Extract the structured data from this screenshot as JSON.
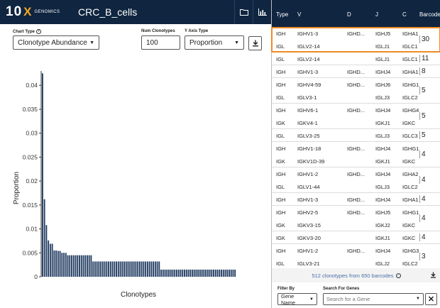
{
  "header": {
    "logo_ten": "10",
    "logo_x": "X",
    "logo_genomics": "GENOMICS",
    "title": "CRC_B_cells",
    "folder_icon": "folder-icon",
    "chart_icon": "bar-chart-icon"
  },
  "controls": {
    "chart_type_label": "Chart Type",
    "chart_type_value": "Clonotype Abundance",
    "num_clonotypes_label": "Num Clonotypes",
    "num_clonotypes_value": "100",
    "y_axis_label": "Y Axis Type",
    "y_axis_value": "Proportion",
    "download_icon": "download-icon"
  },
  "chart_data": {
    "type": "bar",
    "xlabel": "Clonotypes",
    "ylabel": "Proportion",
    "ylim": [
      0,
      0.043
    ],
    "yticks": [
      "0",
      "0.005",
      "0.01",
      "0.015",
      "0.02",
      "0.025",
      "0.03",
      "0.035",
      "0.04"
    ],
    "values": [
      0.0425,
      0.0162,
      0.0108,
      0.0076,
      0.0069,
      0.0069,
      0.0055,
      0.0055,
      0.0054,
      0.0054,
      0.005,
      0.005,
      0.005,
      0.0045,
      0.0045,
      0.0045,
      0.0045,
      0.0045,
      0.0045,
      0.0045,
      0.0045,
      0.0045,
      0.0045,
      0.0045,
      0.0045,
      0.0045,
      0.0032,
      0.0032,
      0.0032,
      0.0032,
      0.0032,
      0.0032,
      0.0032,
      0.0032,
      0.0032,
      0.0032,
      0.0032,
      0.0032,
      0.0032,
      0.0032,
      0.0032,
      0.0032,
      0.0032,
      0.0032,
      0.0032,
      0.0032,
      0.0032,
      0.0032,
      0.0032,
      0.0032,
      0.0032,
      0.0032,
      0.0032,
      0.0032,
      0.0032,
      0.0032,
      0.0032,
      0.0032,
      0.0032,
      0.0032,
      0.0032,
      0.0015,
      0.0015,
      0.0015,
      0.0015,
      0.0015,
      0.0015,
      0.0015,
      0.0015,
      0.0015,
      0.0015,
      0.0015,
      0.0015,
      0.0015,
      0.0015,
      0.0015,
      0.0015,
      0.0015,
      0.0015,
      0.0015,
      0.0015,
      0.0015,
      0.0015,
      0.0015,
      0.0015,
      0.0015,
      0.0015,
      0.0015,
      0.0015,
      0.0015,
      0.0015,
      0.0015,
      0.0015,
      0.0015,
      0.0015,
      0.0015,
      0.0015,
      0.0015,
      0.0015,
      0.0015
    ],
    "bar_color": "#1f3a5f",
    "grid": false
  },
  "table": {
    "headers": [
      "Type",
      "V",
      "D",
      "J",
      "C",
      "Barcodes"
    ],
    "groups": [
      {
        "rows": [
          [
            "IGH",
            "IGHV1-3",
            "IGHD...",
            "IGHJ5",
            "IGHA1"
          ],
          [
            "IGL",
            "IGLV2-14",
            "",
            "IGLJ1",
            "IGLC1"
          ]
        ],
        "barcodes": "30"
      },
      {
        "rows": [
          [
            "IGL",
            "IGLV2-14",
            "",
            "IGLJ1",
            "IGLC1"
          ]
        ],
        "barcodes": "11"
      },
      {
        "rows": [
          [
            "IGH",
            "IGHV1-3",
            "IGHD...",
            "IGHJ4",
            "IGHA1"
          ]
        ],
        "barcodes": "8"
      },
      {
        "rows": [
          [
            "IGH",
            "IGHV4-59",
            "IGHD...",
            "IGHJ6",
            "IGHG1"
          ],
          [
            "IGL",
            "IGLV3-1",
            "",
            "IGLJ3",
            "IGLC2"
          ]
        ],
        "barcodes": "5"
      },
      {
        "rows": [
          [
            "IGH",
            "IGHV6-1",
            "IGHD...",
            "IGHJ4",
            "IGHG4"
          ],
          [
            "IGK",
            "IGKV4-1",
            "",
            "IGKJ1",
            "IGKC"
          ]
        ],
        "barcodes": "5"
      },
      {
        "rows": [
          [
            "IGL",
            "IGLV3-25",
            "",
            "IGLJ3",
            "IGLC3"
          ]
        ],
        "barcodes": "5"
      },
      {
        "rows": [
          [
            "IGH",
            "IGHV1-18",
            "IGHD...",
            "IGHJ4",
            "IGHG1"
          ],
          [
            "IGK",
            "IGKV1D-39",
            "",
            "IGKJ1",
            "IGKC"
          ]
        ],
        "barcodes": "4"
      },
      {
        "rows": [
          [
            "IGH",
            "IGHV1-2",
            "IGHD...",
            "IGHJ4",
            "IGHA2"
          ],
          [
            "IGL",
            "IGLV1-44",
            "",
            "IGLJ3",
            "IGLC2"
          ]
        ],
        "barcodes": "4"
      },
      {
        "rows": [
          [
            "IGH",
            "IGHV1-3",
            "IGHD...",
            "IGHJ4",
            "IGHA1"
          ]
        ],
        "barcodes": "4"
      },
      {
        "rows": [
          [
            "IGH",
            "IGHV2-5",
            "IGHD...",
            "IGHJ5",
            "IGHG1"
          ],
          [
            "IGK",
            "IGKV3-15",
            "",
            "IGKJ2",
            "IGKC"
          ]
        ],
        "barcodes": "4"
      },
      {
        "rows": [
          [
            "IGK",
            "IGKV3-20",
            "",
            "IGKJ1",
            "IGKC"
          ]
        ],
        "barcodes": "4"
      },
      {
        "rows": [
          [
            "IGH",
            "IGHV1-2",
            "IGHD...",
            "IGHJ4",
            "IGHG3"
          ],
          [
            "IGL",
            "IGLV3-21",
            "",
            "IGLJ2",
            "IGLC2"
          ]
        ],
        "barcodes": "3"
      }
    ],
    "summary": "512 clonotypes from 650 barcodes",
    "highlight_color": "#f08a24"
  },
  "filter": {
    "filter_by_label": "Filter By",
    "filter_by_value": "Gene Name",
    "search_label": "Search For Genes",
    "search_placeholder": "Search for a Gene",
    "clear_icon": "close-icon"
  }
}
